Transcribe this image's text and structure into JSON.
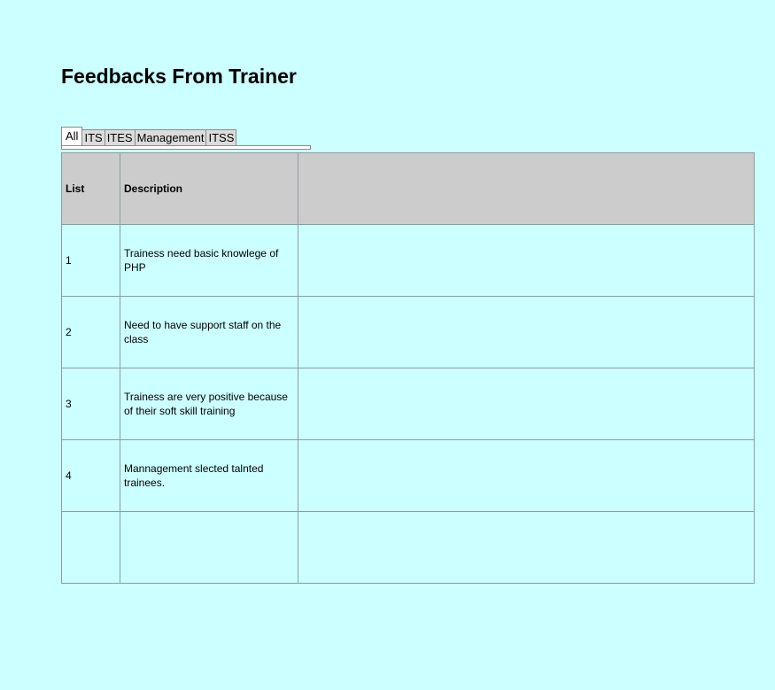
{
  "page": {
    "title": "Feedbacks From Trainer"
  },
  "tabs": [
    {
      "label": "All",
      "active": true
    },
    {
      "label": "ITS",
      "active": false
    },
    {
      "label": "ITES",
      "active": false
    },
    {
      "label": "Management",
      "active": false
    },
    {
      "label": "ITSS",
      "active": false
    }
  ],
  "table": {
    "headers": {
      "list": "List",
      "description": "Description",
      "extra": ""
    },
    "rows": [
      {
        "list": "1",
        "description": "Trainess need basic knowlege of PHP",
        "extra": ""
      },
      {
        "list": "2",
        "description": "Need to have support staff on the class",
        "extra": ""
      },
      {
        "list": "3",
        "description": "Trainess are very positive because of their soft skill training",
        "extra": ""
      },
      {
        "list": "4",
        "description": "Mannagement slected talnted trainees.",
        "extra": ""
      },
      {
        "list": "",
        "description": "",
        "extra": ""
      }
    ]
  }
}
